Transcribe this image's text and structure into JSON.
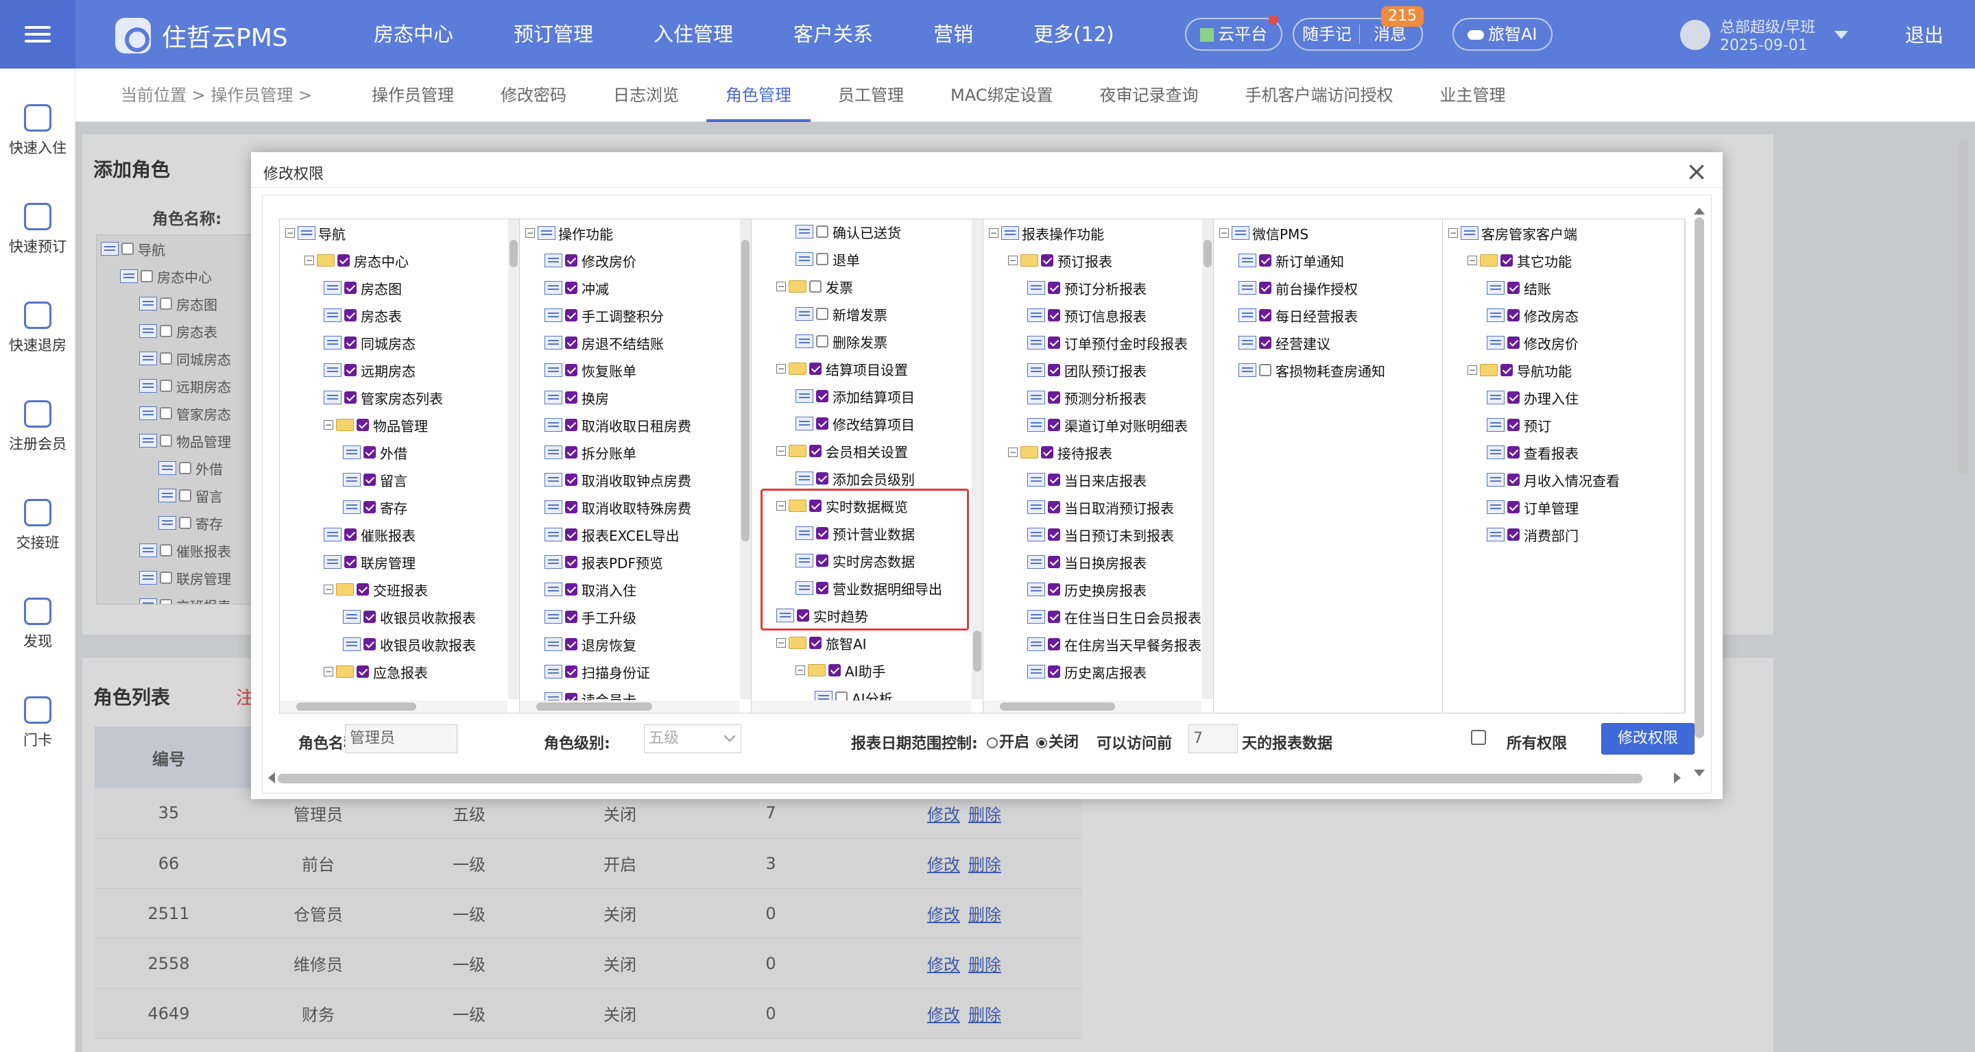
{
  "topbar": {
    "app_name": "住哲云PMS",
    "nav": [
      "房态中心",
      "预订管理",
      "入住管理",
      "客户关系",
      "营销",
      "更多(12)"
    ],
    "cloud": "云平台",
    "notes": "随手记",
    "messages": "消息",
    "message_count": "215",
    "ai": "旅智AI",
    "user_name": "总部超级/早班",
    "user_date": "2025-09-01",
    "logout": "退出"
  },
  "sidebar": {
    "items": [
      "快速入住",
      "快速预订",
      "快速退房",
      "注册会员",
      "交接班",
      "发现",
      "门卡"
    ]
  },
  "subnav": {
    "crumb": "当前位置 > 操作员管理 >",
    "tabs": [
      "操作员管理",
      "修改密码",
      "日志浏览",
      "角色管理",
      "员工管理",
      "MAC绑定设置",
      "夜审记录查询",
      "手机客户端访问授权",
      "业主管理"
    ],
    "active_tab": "角色管理"
  },
  "background": {
    "add_role_title": "添加角色",
    "role_name_label": "角色名称:",
    "role_list_title": "角色列表",
    "role_list_note": "注",
    "bg_tree": [
      "导航",
      "房态中心",
      "房态图",
      "房态表",
      "同城房态",
      "远期房态",
      "管家房态",
      "物品管理",
      "外借",
      "留言",
      "寄存",
      "催账报表",
      "联房管理",
      "交班报表"
    ],
    "table_headers": [
      "编号",
      "",
      "",
      "",
      "",
      ""
    ],
    "table_rows": [
      {
        "id": "35",
        "name": "管理员",
        "level": "五级",
        "ctrl": "关闭",
        "days": "7"
      },
      {
        "id": "66",
        "name": "前台",
        "level": "一级",
        "ctrl": "开启",
        "days": "3"
      },
      {
        "id": "2511",
        "name": "仓管员",
        "level": "一级",
        "ctrl": "关闭",
        "days": "0"
      },
      {
        "id": "2558",
        "name": "维修员",
        "level": "一级",
        "ctrl": "关闭",
        "days": "0"
      },
      {
        "id": "4649",
        "name": "财务",
        "level": "一级",
        "ctrl": "关闭",
        "days": "0"
      }
    ],
    "edit_link": "修改",
    "delete_link": "删除"
  },
  "modal": {
    "title": "修改权限",
    "close": "×",
    "panels": [
      {
        "nodes": [
          {
            "label": "导航",
            "type": "root",
            "depth": 0,
            "checked": false
          },
          {
            "label": "房态中心",
            "type": "folder",
            "depth": 1,
            "checked": true
          },
          {
            "label": "房态图",
            "type": "page",
            "depth": 2,
            "checked": true
          },
          {
            "label": "房态表",
            "type": "page",
            "depth": 2,
            "checked": true
          },
          {
            "label": "同城房态",
            "type": "page",
            "depth": 2,
            "checked": true
          },
          {
            "label": "远期房态",
            "type": "page",
            "depth": 2,
            "checked": true
          },
          {
            "label": "管家房态列表",
            "type": "page",
            "depth": 2,
            "checked": true
          },
          {
            "label": "物品管理",
            "type": "folder",
            "depth": 2,
            "checked": true
          },
          {
            "label": "外借",
            "type": "page",
            "depth": 3,
            "checked": true
          },
          {
            "label": "留言",
            "type": "page",
            "depth": 3,
            "checked": true
          },
          {
            "label": "寄存",
            "type": "page",
            "depth": 3,
            "checked": true
          },
          {
            "label": "催账报表",
            "type": "page",
            "depth": 2,
            "checked": true
          },
          {
            "label": "联房管理",
            "type": "page",
            "depth": 2,
            "checked": true
          },
          {
            "label": "交班报表",
            "type": "folder",
            "depth": 2,
            "checked": true
          },
          {
            "label": "收银员收款报表",
            "type": "page",
            "depth": 3,
            "checked": true
          },
          {
            "label": "收银员收款报表",
            "type": "page",
            "depth": 3,
            "checked": true
          },
          {
            "label": "应急报表",
            "type": "folder",
            "depth": 2,
            "checked": true
          }
        ]
      },
      {
        "nodes": [
          {
            "label": "操作功能",
            "type": "root",
            "depth": 0,
            "checked": false
          },
          {
            "label": "修改房价",
            "type": "page",
            "depth": 1,
            "checked": true
          },
          {
            "label": "冲减",
            "type": "page",
            "depth": 1,
            "checked": true
          },
          {
            "label": "手工调整积分",
            "type": "page",
            "depth": 1,
            "checked": true
          },
          {
            "label": "房退不结结账",
            "type": "page",
            "depth": 1,
            "checked": true
          },
          {
            "label": "恢复账单",
            "type": "page",
            "depth": 1,
            "checked": true
          },
          {
            "label": "换房",
            "type": "page",
            "depth": 1,
            "checked": true
          },
          {
            "label": "取消收取日租房费",
            "type": "page",
            "depth": 1,
            "checked": true
          },
          {
            "label": "拆分账单",
            "type": "page",
            "depth": 1,
            "checked": true
          },
          {
            "label": "取消收取钟点房费",
            "type": "page",
            "depth": 1,
            "checked": true
          },
          {
            "label": "取消收取特殊房费",
            "type": "page",
            "depth": 1,
            "checked": true
          },
          {
            "label": "报表EXCEL导出",
            "type": "page",
            "depth": 1,
            "checked": true
          },
          {
            "label": "报表PDF预览",
            "type": "page",
            "depth": 1,
            "checked": true
          },
          {
            "label": "取消入住",
            "type": "page",
            "depth": 1,
            "checked": true
          },
          {
            "label": "手工升级",
            "type": "page",
            "depth": 1,
            "checked": true
          },
          {
            "label": "退房恢复",
            "type": "page",
            "depth": 1,
            "checked": true
          },
          {
            "label": "扫描身份证",
            "type": "page",
            "depth": 1,
            "checked": true
          },
          {
            "label": "读会员卡",
            "type": "page",
            "depth": 1,
            "checked": true
          }
        ]
      },
      {
        "nodes": [
          {
            "label": "确认已送货",
            "type": "page",
            "depth": 2,
            "checked": false
          },
          {
            "label": "退单",
            "type": "page",
            "depth": 2,
            "checked": false
          },
          {
            "label": "发票",
            "type": "folder",
            "depth": 1,
            "checked": false
          },
          {
            "label": "新增发票",
            "type": "page",
            "depth": 2,
            "checked": false
          },
          {
            "label": "删除发票",
            "type": "page",
            "depth": 2,
            "checked": false
          },
          {
            "label": "结算项目设置",
            "type": "folder",
            "depth": 1,
            "checked": true
          },
          {
            "label": "添加结算项目",
            "type": "page",
            "depth": 2,
            "checked": true
          },
          {
            "label": "修改结算项目",
            "type": "page",
            "depth": 2,
            "checked": true
          },
          {
            "label": "会员相关设置",
            "type": "folder",
            "depth": 1,
            "checked": true
          },
          {
            "label": "添加会员级别",
            "type": "page",
            "depth": 2,
            "checked": true
          },
          {
            "label": "实时数据概览",
            "type": "folder",
            "depth": 1,
            "checked": true
          },
          {
            "label": "预计营业数据",
            "type": "page",
            "depth": 2,
            "checked": true
          },
          {
            "label": "实时房态数据",
            "type": "page",
            "depth": 2,
            "checked": true
          },
          {
            "label": "营业数据明细导出",
            "type": "page",
            "depth": 2,
            "checked": true
          },
          {
            "label": "实时趋势",
            "type": "page",
            "depth": 1,
            "checked": true
          },
          {
            "label": "旅智AI",
            "type": "folder",
            "depth": 1,
            "checked": true
          },
          {
            "label": "AI助手",
            "type": "folder",
            "depth": 2,
            "checked": true
          },
          {
            "label": "AI分析",
            "type": "page",
            "depth": 3,
            "checked": false
          }
        ]
      },
      {
        "nodes": [
          {
            "label": "报表操作功能",
            "type": "root",
            "depth": 0,
            "checked": false
          },
          {
            "label": "预订报表",
            "type": "folder",
            "depth": 1,
            "checked": true
          },
          {
            "label": "预订分析报表",
            "type": "page",
            "depth": 2,
            "checked": true
          },
          {
            "label": "预订信息报表",
            "type": "page",
            "depth": 2,
            "checked": true
          },
          {
            "label": "订单预付金时段报表",
            "type": "page",
            "depth": 2,
            "checked": true
          },
          {
            "label": "团队预订报表",
            "type": "page",
            "depth": 2,
            "checked": true
          },
          {
            "label": "预测分析报表",
            "type": "page",
            "depth": 2,
            "checked": true
          },
          {
            "label": "渠道订单对账明细表",
            "type": "page",
            "depth": 2,
            "checked": true
          },
          {
            "label": "接待报表",
            "type": "folder",
            "depth": 1,
            "checked": true
          },
          {
            "label": "当日来店报表",
            "type": "page",
            "depth": 2,
            "checked": true
          },
          {
            "label": "当日取消预订报表",
            "type": "page",
            "depth": 2,
            "checked": true
          },
          {
            "label": "当日预订未到报表",
            "type": "page",
            "depth": 2,
            "checked": true
          },
          {
            "label": "当日换房报表",
            "type": "page",
            "depth": 2,
            "checked": true
          },
          {
            "label": "历史换房报表",
            "type": "page",
            "depth": 2,
            "checked": true
          },
          {
            "label": "在住当日生日会员报表",
            "type": "page",
            "depth": 2,
            "checked": true
          },
          {
            "label": "在住房当天早餐务报表",
            "type": "page",
            "depth": 2,
            "checked": true
          },
          {
            "label": "历史离店报表",
            "type": "page",
            "depth": 2,
            "checked": true
          }
        ]
      },
      {
        "nodes": [
          {
            "label": "微信PMS",
            "type": "root",
            "depth": 0,
            "checked": false
          },
          {
            "label": "新订单通知",
            "type": "page",
            "depth": 1,
            "checked": true
          },
          {
            "label": "前台操作授权",
            "type": "page",
            "depth": 1,
            "checked": true
          },
          {
            "label": "每日经营报表",
            "type": "page",
            "depth": 1,
            "checked": true
          },
          {
            "label": "经营建议",
            "type": "page",
            "depth": 1,
            "checked": true
          },
          {
            "label": "客损物耗查房通知",
            "type": "page",
            "depth": 1,
            "checked": false
          }
        ]
      },
      {
        "nodes": [
          {
            "label": "客房管家客户端",
            "type": "root",
            "depth": 0,
            "checked": false
          },
          {
            "label": "其它功能",
            "type": "folder",
            "depth": 1,
            "checked": true
          },
          {
            "label": "结账",
            "type": "page",
            "depth": 2,
            "checked": true
          },
          {
            "label": "修改房态",
            "type": "page",
            "depth": 2,
            "checked": true
          },
          {
            "label": "修改房价",
            "type": "page",
            "depth": 2,
            "checked": true
          },
          {
            "label": "导航功能",
            "type": "folder",
            "depth": 1,
            "checked": true
          },
          {
            "label": "办理入住",
            "type": "page",
            "depth": 2,
            "checked": true
          },
          {
            "label": "预订",
            "type": "page",
            "depth": 2,
            "checked": true
          },
          {
            "label": "查看报表",
            "type": "page",
            "depth": 2,
            "checked": true
          },
          {
            "label": "月收入情况查看",
            "type": "page",
            "depth": 2,
            "checked": true
          },
          {
            "label": "订单管理",
            "type": "page",
            "depth": 2,
            "checked": true
          },
          {
            "label": "消费部门",
            "type": "page",
            "depth": 2,
            "checked": true
          }
        ]
      }
    ],
    "form": {
      "role_name_label": "角色名称:",
      "role_name_value": "管理员",
      "role_level_label": "角色级别:",
      "role_level_value": "五级",
      "date_ctrl_label": "报表日期范围控制:",
      "on_label": "开启",
      "off_label": "关闭",
      "range_prefix": "可以访问前",
      "range_days": "7",
      "range_suffix": "天的报表数据",
      "all_perm_label": "所有权限",
      "submit": "修改权限"
    }
  }
}
